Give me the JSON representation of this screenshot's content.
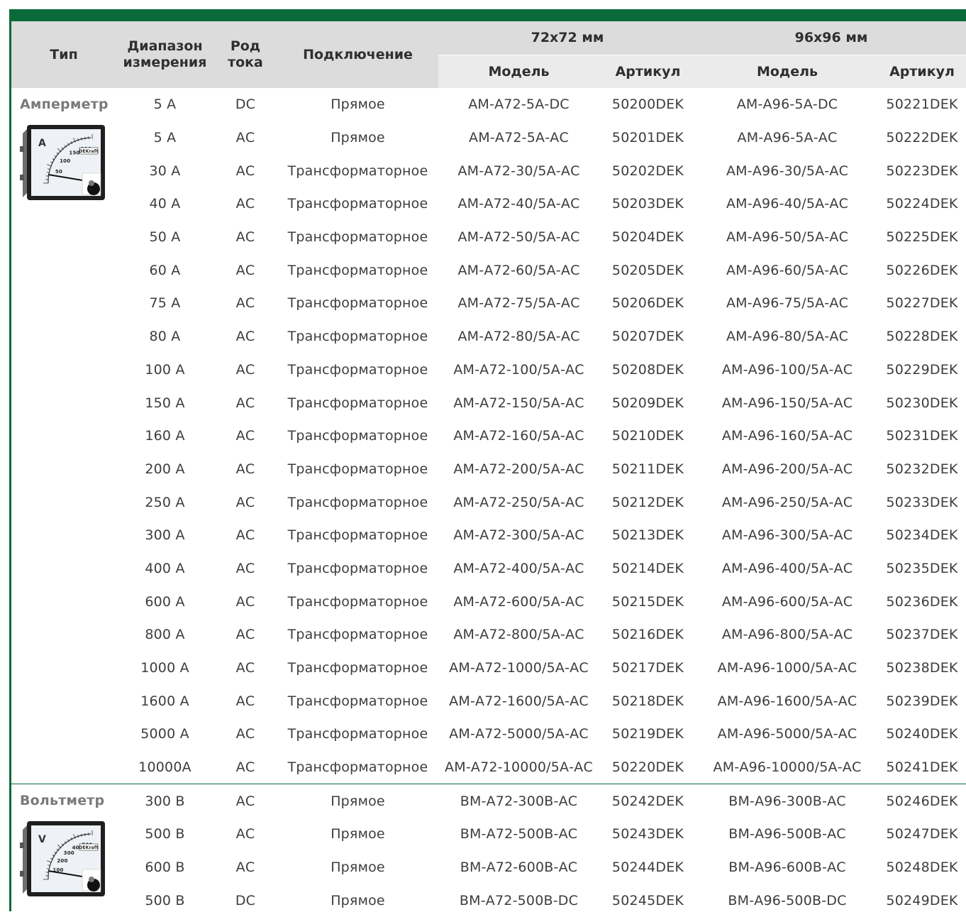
{
  "header": {
    "type": "Тип",
    "range": [
      "Диапазон",
      "измерения"
    ],
    "current": [
      "Род",
      "тока"
    ],
    "connection": "Подключение",
    "group72": "72х72 мм",
    "group96": "96х96 мм",
    "model": "Модель",
    "article": "Артикул"
  },
  "colors": {
    "brand_green": "#0a6a3a",
    "header_gray": "#dcdcdc",
    "subheader_gray": "#ebebeb"
  },
  "sections": [
    {
      "type": "Амперметр",
      "icon": "ammeter-icon",
      "dial_letter": "A",
      "dial_ticks": [
        "50",
        "100",
        "150",
        "200"
      ],
      "brand": "DEKraft",
      "rows": [
        [
          "5 А",
          "DC",
          "Прямое",
          "АМ-А72-5А-DC",
          "50200DEK",
          "АМ-А96-5А-DC",
          "50221DEK"
        ],
        [
          "5 А",
          "АС",
          "Прямое",
          "АМ-А72-5А-АС",
          "50201DEK",
          "АМ-А96-5А-АС",
          "50222DEK"
        ],
        [
          "30 А",
          "АС",
          "Трансформаторное",
          "АМ-А72-30/5А-АС",
          "50202DEK",
          "АМ-А96-30/5А-АС",
          "50223DEK"
        ],
        [
          "40 А",
          "АС",
          "Трансформаторное",
          "АМ-А72-40/5А-АС",
          "50203DEK",
          "АМ-А96-40/5А-АС",
          "50224DEK"
        ],
        [
          "50 А",
          "АС",
          "Трансформаторное",
          "АМ-А72-50/5А-АС",
          "50204DEK",
          "АМ-А96-50/5А-АС",
          "50225DEK"
        ],
        [
          "60 А",
          "АС",
          "Трансформаторное",
          "АМ-А72-60/5А-АС",
          "50205DEK",
          "АМ-А96-60/5А-АС",
          "50226DEK"
        ],
        [
          "75 А",
          "АС",
          "Трансформаторное",
          "АМ-А72-75/5А-АС",
          "50206DEK",
          "АМ-А96-75/5А-АС",
          "50227DEK"
        ],
        [
          "80 А",
          "АС",
          "Трансформаторное",
          "АМ-А72-80/5А-АС",
          "50207DEK",
          "АМ-А96-80/5А-АС",
          "50228DEK"
        ],
        [
          "100 А",
          "АС",
          "Трансформаторное",
          "АМ-А72-100/5А-АС",
          "50208DEK",
          "АМ-А96-100/5А-АС",
          "50229DEK"
        ],
        [
          "150 А",
          "АС",
          "Трансформаторное",
          "АМ-А72-150/5А-АС",
          "50209DEK",
          "АМ-А96-150/5А-АС",
          "50230DEK"
        ],
        [
          "160 А",
          "АС",
          "Трансформаторное",
          "АМ-А72-160/5А-АС",
          "50210DEK",
          "АМ-А96-160/5А-АС",
          "50231DEK"
        ],
        [
          "200 А",
          "АС",
          "Трансформаторное",
          "АМ-А72-200/5А-АС",
          "50211DEK",
          "АМ-А96-200/5А-АС",
          "50232DEK"
        ],
        [
          "250 А",
          "АС",
          "Трансформаторное",
          "АМ-А72-250/5А-АС",
          "50212DEK",
          "АМ-А96-250/5А-АС",
          "50233DEK"
        ],
        [
          "300 А",
          "АС",
          "Трансформаторное",
          "АМ-А72-300/5А-АС",
          "50213DEK",
          "АМ-А96-300/5А-АС",
          "50234DEK"
        ],
        [
          "400 А",
          "АС",
          "Трансформаторное",
          "АМ-А72-400/5А-АС",
          "50214DEK",
          "АМ-А96-400/5А-АС",
          "50235DEK"
        ],
        [
          "600 А",
          "АС",
          "Трансформаторное",
          "АМ-А72-600/5А-АС",
          "50215DEK",
          "АМ-А96-600/5А-АС",
          "50236DEK"
        ],
        [
          "800 А",
          "АС",
          "Трансформаторное",
          "АМ-А72-800/5А-АС",
          "50216DEK",
          "АМ-А96-800/5А-АС",
          "50237DEK"
        ],
        [
          "1000 А",
          "АС",
          "Трансформаторное",
          "АМ-А72-1000/5А-АС",
          "50217DEK",
          "АМ-А96-1000/5А-АС",
          "50238DEK"
        ],
        [
          "1600 А",
          "АС",
          "Трансформаторное",
          "АМ-А72-1600/5А-АС",
          "50218DEK",
          "АМ-А96-1600/5А-АС",
          "50239DEK"
        ],
        [
          "5000 А",
          "АС",
          "Трансформаторное",
          "АМ-А72-5000/5А-АС",
          "50219DEK",
          "АМ-А96-5000/5А-АС",
          "50240DEK"
        ],
        [
          "10000А",
          "АС",
          "Трансформаторное",
          "АМ-А72-10000/5А-АС",
          "50220DEK",
          "АМ-А96-10000/5А-АС",
          "50241DEK"
        ]
      ]
    },
    {
      "type": "Вольтметр",
      "icon": "voltmeter-icon",
      "dial_letter": "V",
      "dial_ticks": [
        "100",
        "200",
        "300",
        "400",
        "500"
      ],
      "brand": "DEKraft",
      "rows": [
        [
          "300 В",
          "АС",
          "Прямое",
          "ВМ-А72-300В-АС",
          "50242DEK",
          "ВМ-А96-300В-АС",
          "50246DEK"
        ],
        [
          "500 В",
          "АС",
          "Прямое",
          "ВМ-А72-500В-АС",
          "50243DEK",
          "ВМ-А96-500В-АС",
          "50247DEK"
        ],
        [
          "600 В",
          "АС",
          "Прямое",
          "ВМ-А72-600В-АС",
          "50244DEK",
          "ВМ-А96-600В-АС",
          "50248DEK"
        ],
        [
          "500 В",
          "DC",
          "Прямое",
          "ВМ-А72-500В-DC",
          "50245DEK",
          "ВМ-А96-500В-DC",
          "50249DEK"
        ]
      ]
    }
  ]
}
